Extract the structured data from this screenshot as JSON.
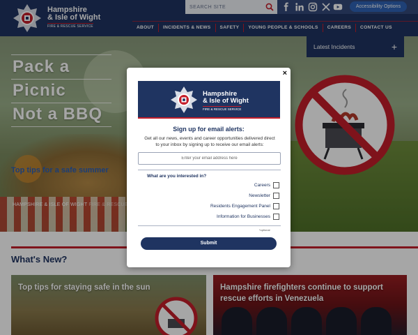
{
  "header": {
    "logo_line1": "Hampshire",
    "logo_line2": "& Isle of Wight",
    "logo_sub": "FIRE & RESCUE SERVICE",
    "search_placeholder": "SEARCH SITE",
    "social_icons": [
      "facebook-icon",
      "linkedin-icon",
      "instagram-icon",
      "x-icon",
      "youtube-icon"
    ],
    "accessibility_label": "Accessibility Options",
    "nav": [
      "ABOUT",
      "INCIDENTS & NEWS",
      "SAFETY",
      "YOUNG PEOPLE & SCHOOLS",
      "CAREERS",
      "CONTACT US"
    ]
  },
  "hero": {
    "title_lines": [
      "Pack a",
      "Picnic",
      "Not a BBQ"
    ],
    "link": "Top tips for a safe summer",
    "breadcrumb_home": "HAMPSHIRE & ISLE OF WIGHT",
    "breadcrumb_rest": "FIRE & RESCUE SERVICE"
  },
  "latest_incidents": {
    "label": "Latest Incidents",
    "toggle": "+"
  },
  "whats_new": {
    "heading": "What's New?",
    "cards": [
      {
        "title": "Top tips for staying safe in the sun"
      },
      {
        "title": "Hampshire firefighters continue to support rescue efforts in Venezuela"
      }
    ]
  },
  "modal": {
    "close": "×",
    "logo_line1": "Hampshire",
    "logo_line2": "& Isle of Wight",
    "logo_sub": "FIRE & RESCUE SERVICE",
    "heading": "Sign up for email alerts:",
    "description": "Get all our news, events and career opportunities delivered direct to your inbox by signing up to receive our email alerts:",
    "email_placeholder": "Enter your email address here",
    "interest_heading": "What are you interested in?",
    "options": [
      "Careers",
      "Newsletter",
      "Residents Engagement Panel",
      "Information for Businesses"
    ],
    "optional_note": "*optional",
    "submit": "Submit"
  },
  "colors": {
    "navy": "#1f3461",
    "accent_red": "#c41e2a",
    "accessibility_blue": "#2f63b5"
  }
}
